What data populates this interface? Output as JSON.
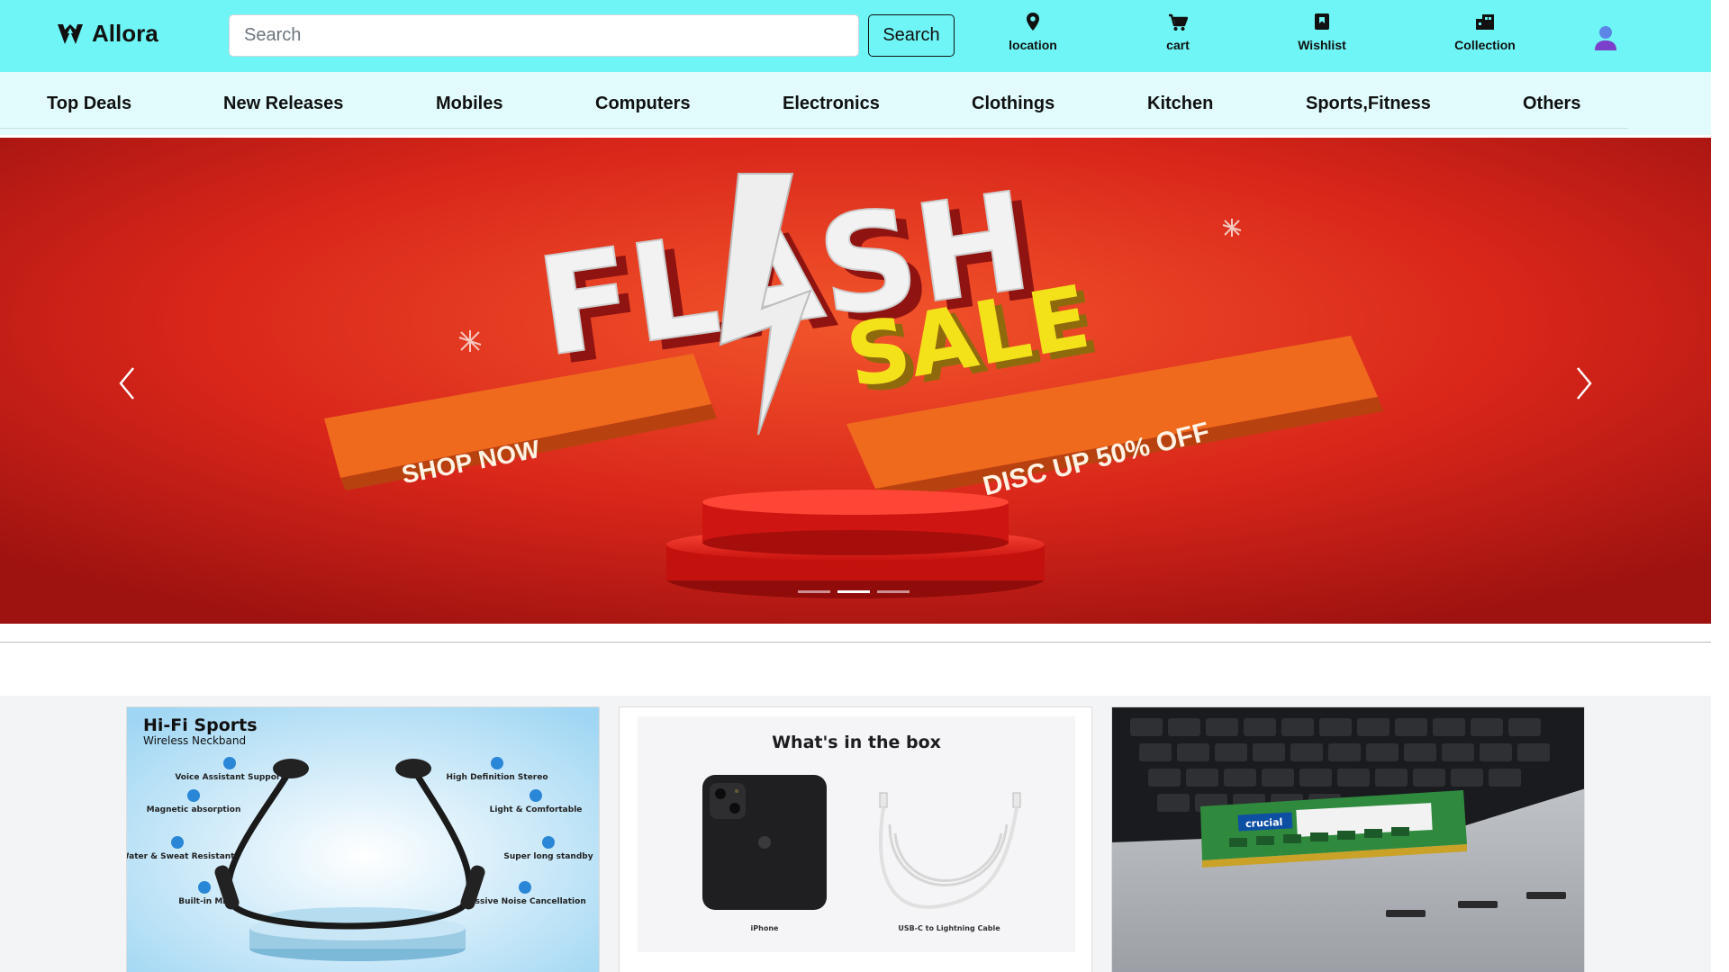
{
  "header": {
    "brand": "Allora",
    "search_placeholder": "Search",
    "search_button": "Search",
    "icons": [
      {
        "name": "location",
        "label": "location",
        "icon": "map-pin-icon"
      },
      {
        "name": "cart",
        "label": "cart",
        "icon": "shopping-cart-icon"
      },
      {
        "name": "wishlist",
        "label": "Wishlist",
        "icon": "bookmark-icon"
      },
      {
        "name": "collection",
        "label": "Collection",
        "icon": "collection-icon"
      }
    ],
    "user_icon": "user-avatar-icon",
    "bg_color": "#6ff5f5"
  },
  "nav": {
    "items": [
      "Top Deals",
      "New Releases",
      "Mobiles",
      "Computers",
      "Electronics",
      "Clothings",
      "Kitchen",
      "Sports,Fitness",
      "Others"
    ],
    "bg_color": "#e2fcfd"
  },
  "carousel": {
    "banner": {
      "headline_1": "FLASH",
      "headline_2": "SALE",
      "ribbon_left": "SHOP NOW",
      "ribbon_right": "DISC UP 50% OFF"
    },
    "slide_count": 3,
    "active_slide": 2,
    "prev_icon": "chevron-left-icon",
    "next_icon": "chevron-right-icon",
    "banner_color": "#e8321d"
  },
  "cards": [
    {
      "title": "Hi-Fi Sports",
      "subtitle": "Wireless Neckband",
      "features": [
        "Voice Assistant Support",
        "High Definition Stereo",
        "Magnetic absorption",
        "Light & Comfortable",
        "Water & Sweat Resistant",
        "Super long standby",
        "Built-in Mic",
        "Passive Noise Cancellation"
      ]
    },
    {
      "title": "What's in the box",
      "items": [
        "iPhone",
        "USB-C to Lightning Cable"
      ]
    },
    {
      "brand": "crucial"
    }
  ]
}
